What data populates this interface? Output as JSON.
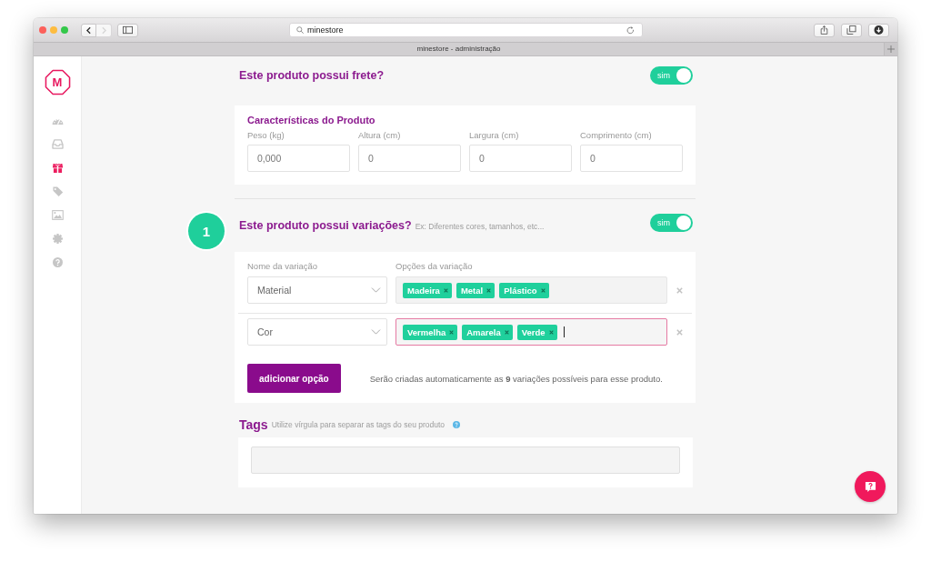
{
  "browser": {
    "nav": [
      {
        "kind": "back",
        "disabled": false
      },
      {
        "kind": "forward",
        "disabled": true
      }
    ],
    "address": "minestore",
    "tab_title": "minestore - administração"
  },
  "sidebar": {
    "logo": "M",
    "items": [
      {
        "kind": "gauge",
        "selected": false
      },
      {
        "kind": "tray",
        "selected": false
      },
      {
        "kind": "gift",
        "selected": true
      },
      {
        "kind": "tag",
        "selected": false
      },
      {
        "kind": "image",
        "selected": false
      },
      {
        "kind": "gear",
        "selected": false
      },
      {
        "kind": "help",
        "selected": false
      }
    ]
  },
  "shipping": {
    "question": "Este produto possui frete?",
    "toggle": {
      "label": "sim",
      "on": true
    },
    "card": {
      "title": "Características do Produto",
      "fields": [
        {
          "label": "Peso (kg)",
          "value": "0,000"
        },
        {
          "label": "Altura (cm)",
          "value": "0"
        },
        {
          "label": "Largura (cm)",
          "value": "0"
        },
        {
          "label": "Comprimento (cm)",
          "value": "0"
        }
      ]
    }
  },
  "variations": {
    "step": "1",
    "question": "Este produto possui variações?",
    "hint": "Ex: Diferentes cores, tamanhos, etc...",
    "toggle": {
      "label": "sim",
      "on": true
    },
    "columns": [
      "Nome da variação",
      "Opções da variação"
    ],
    "rows": [
      {
        "name": "Material",
        "focused": false,
        "options": [
          "Madeira",
          "Metal",
          "Plástico"
        ]
      },
      {
        "name": "Cor",
        "focused": true,
        "options": [
          "Vermelha",
          "Amarela",
          "Verde"
        ]
      }
    ],
    "add_button": "adicionar opção",
    "summary": "Serão criadas automaticamente as **9** variações possíveis para esse produto."
  },
  "tags": {
    "title": "Tags",
    "hint": "Utilize vírgula para separar as tags do seu produto"
  }
}
